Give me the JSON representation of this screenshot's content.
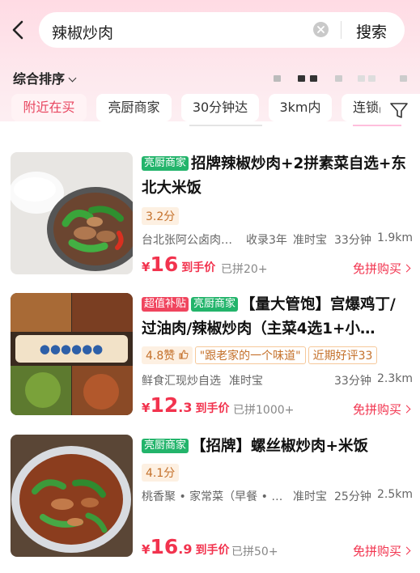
{
  "header": {
    "search_value": "辣椒炒肉",
    "search_button": "搜索"
  },
  "sort": {
    "label": "综合排序"
  },
  "chips": [
    "附近在买",
    "亮厨商家",
    "30分钟达",
    "3km内",
    "连锁品"
  ],
  "products": [
    {
      "tags": [
        "亮厨商家"
      ],
      "title": "招牌辣椒炒肉+2拼素菜自选+东北大米饭",
      "rating": "3.2分",
      "shop": "台北张阿公卤肉…",
      "extra": "收录3年",
      "punctual": "准时宝",
      "time": "33分钟",
      "distance": "1.9km",
      "price_yen": "¥",
      "price_int": "16",
      "price_dec": "",
      "price_label": "到手价",
      "sold": "已拼20+",
      "action": "免拼购买"
    },
    {
      "tags": [
        "超值补贴",
        "亮厨商家"
      ],
      "title": "【量大管饱】宫爆鸡丁/过油肉/辣椒炒肉（主菜4选1+小…",
      "rating": "4.8赞",
      "quote": "\"跟老家的一个味道\"",
      "review": "近期好评33",
      "shop": "鲜食汇现炒自选",
      "punctual": "准时宝",
      "time": "33分钟",
      "distance": "2.3km",
      "price_yen": "¥",
      "price_int": "12",
      "price_dec": ".3",
      "price_label": "到手价",
      "sold": "已拼1000+",
      "action": "免拼购买"
    },
    {
      "tags": [
        "亮厨商家"
      ],
      "title": "【招牌】螺丝椒炒肉+米饭",
      "rating": "4.1分",
      "shop": "桃香聚 • 家常菜（早餐 • …",
      "punctual": "准时宝",
      "time": "25分钟",
      "distance": "2.5km",
      "price_yen": "¥",
      "price_int": "16",
      "price_dec": ".9",
      "price_label": "到手价",
      "sold": "已拼50+",
      "action": "免拼购买"
    }
  ],
  "colors": {
    "accent": "#f2334e",
    "green_tag": "#23b46b",
    "header_pink": "#ffdbe4"
  }
}
